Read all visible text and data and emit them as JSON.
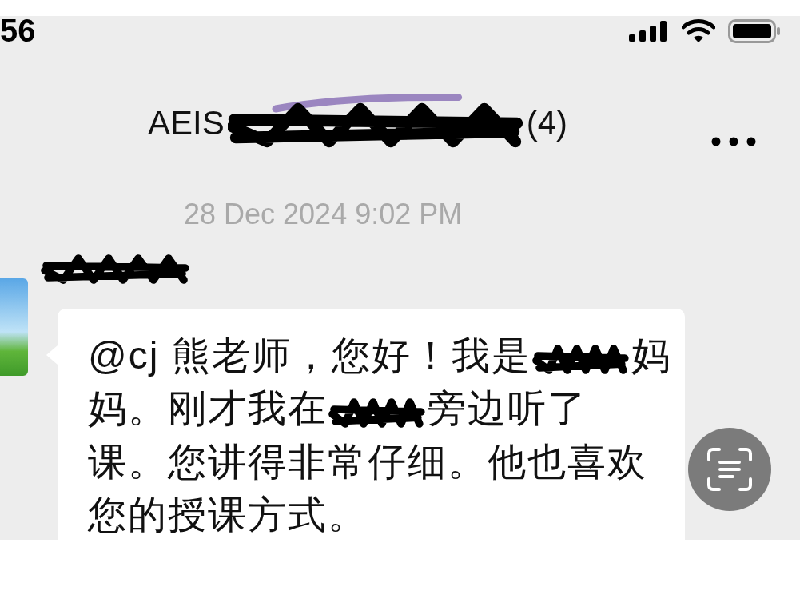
{
  "status_bar": {
    "time": "56"
  },
  "header": {
    "title_start": "AEIS",
    "title_redacted": true,
    "title_end": "(4)"
  },
  "timestamp": "28 Dec 2024 9:02 PM",
  "message": {
    "sender_redacted": true,
    "lines": [
      [
        {
          "kind": "text",
          "text": "@cj 熊老师，您好！我是"
        },
        {
          "kind": "redaction"
        },
        {
          "kind": "text",
          "text": "妈"
        }
      ],
      [
        {
          "kind": "text",
          "text": "妈。刚才我在"
        },
        {
          "kind": "redaction"
        },
        {
          "kind": "text",
          "text": "旁边听了"
        }
      ],
      [
        {
          "kind": "text",
          "text": "课。您讲得非常仔细。他也喜欢"
        }
      ],
      [
        {
          "kind": "text",
          "text": "您的授课方式。"
        }
      ]
    ]
  }
}
